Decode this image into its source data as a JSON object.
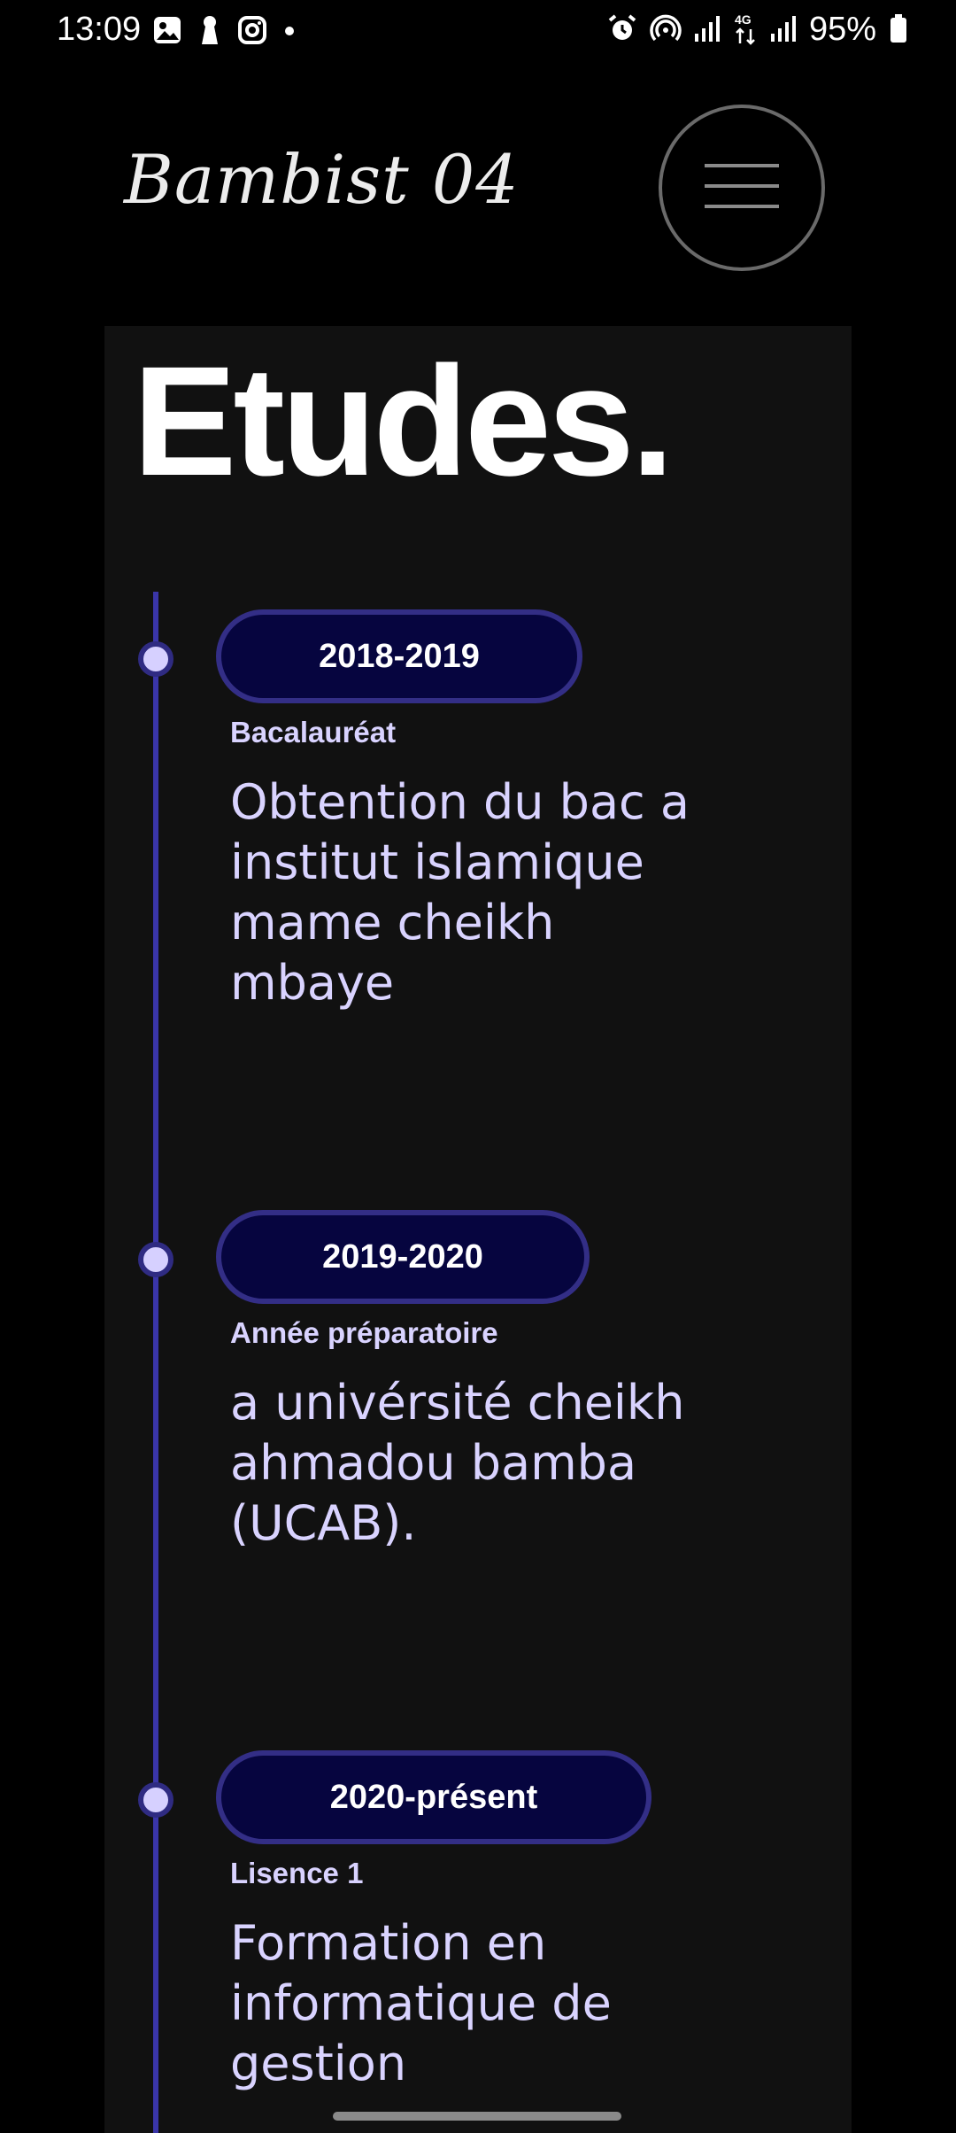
{
  "status_bar": {
    "time": "13:09",
    "battery": "95%",
    "left_icons": [
      "gallery-icon",
      "keyhole-icon",
      "instagram-icon",
      "dot-icon"
    ],
    "right_icons": [
      "alarm-icon",
      "hotspot-icon",
      "signal-icon",
      "network-4g-icon",
      "signal-icon",
      "battery-icon"
    ]
  },
  "header": {
    "logo": "Bambist 04",
    "menu_icon": "hamburger-icon"
  },
  "section": {
    "title": "Etudes."
  },
  "timeline": [
    {
      "year": "2018-2019",
      "title": "Bacalauréat",
      "description": "Obtention du bac a institut islamique mame cheikh mbaye"
    },
    {
      "year": "2019-2020",
      "title": "Année préparatoire",
      "description": "a univérsité cheikh ahmadou bamba (UCAB)."
    },
    {
      "year": "2020-présent",
      "title": "Lisence 1",
      "description": "Formation en informatique de gestion"
    }
  ],
  "colors": {
    "background": "#000000",
    "panel": "#111111",
    "accent_line": "#3a35a8",
    "pill_fill": "#06053f",
    "pill_border": "#332e86",
    "text_lavender": "#d9d3ff"
  }
}
